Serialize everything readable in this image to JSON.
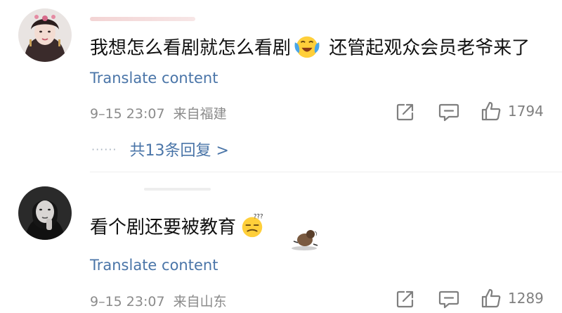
{
  "comments": [
    {
      "avatar_icon": "user-avatar-woman-pink-headdress",
      "text_before": "我想怎么看剧就怎么看剧",
      "emoji_icon": "laughing-crying-emoji",
      "text_after": "还管起观众会员老爷来了",
      "translate": "Translate content",
      "timestamp": "9–15 23:07",
      "location": "来自福建",
      "like_count": "1794",
      "replies_label": "共13条回复 >",
      "replies_dots": "······"
    },
    {
      "avatar_icon": "user-avatar-woman-dark-portrait",
      "text_before": "看个剧还要被教育",
      "emoji_icon": "confused-face-emoji",
      "sticker_icon": "disappointed-mini-figure-sticker",
      "translate": "Translate content",
      "timestamp": "9–15 23:07",
      "location": "来自山东",
      "like_count": "1289"
    }
  ],
  "icons": {
    "share": "share-icon",
    "comment": "comment-icon",
    "like": "thumbs-up-icon"
  },
  "colors": {
    "link": "#4a75a8",
    "meta": "#8b8b8b",
    "icon": "#7f7f7f"
  }
}
